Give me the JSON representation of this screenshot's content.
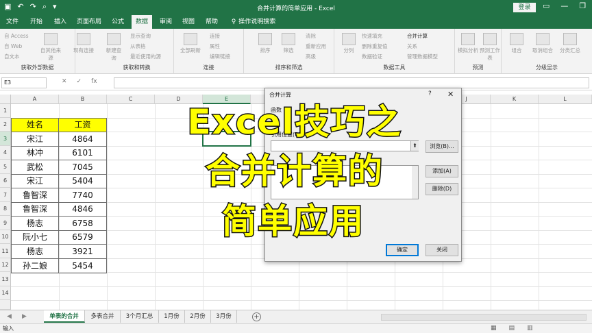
{
  "titlebar": {
    "title": "合并计算的简单应用 - Excel",
    "login": "登录",
    "qat": [
      "▣",
      "↶",
      "↷",
      "⌕",
      "▾"
    ],
    "win": [
      "▭",
      "—",
      "❐",
      "✕"
    ]
  },
  "tabs": [
    "文件",
    "开始",
    "插入",
    "页面布局",
    "公式",
    "数据",
    "审阅",
    "视图",
    "帮助",
    "操作说明搜索"
  ],
  "ribbon": {
    "groups": [
      {
        "label": "获取外部数据",
        "items": [
          "自 Access",
          "自 Web",
          "自文本",
          "自其他来源",
          "现有连接"
        ]
      },
      {
        "label": "获取和转换",
        "items": [
          "新建查询",
          "显示查询",
          "从表格",
          "最近使用的源"
        ]
      },
      {
        "label": "连接",
        "items": [
          "全部刷新",
          "连接",
          "属性",
          "编辑链接"
        ]
      },
      {
        "label": "排序和筛选",
        "items": [
          "排序",
          "筛选",
          "清除",
          "重新应用",
          "高级"
        ]
      },
      {
        "label": "数据工具",
        "items": [
          "分列",
          "快速填充",
          "删除重复值",
          "数据验证",
          "合并计算",
          "关系",
          "管理数据模型"
        ]
      },
      {
        "label": "预测",
        "items": [
          "模拟分析",
          "预测工作表"
        ]
      },
      {
        "label": "分级显示",
        "items": [
          "组合",
          "取消组合",
          "分类汇总"
        ]
      }
    ]
  },
  "formula_bar": {
    "name_box": "E3",
    "icons": [
      "✕",
      "✓",
      "fx"
    ]
  },
  "columns": [
    "A",
    "B",
    "C",
    "D",
    "E",
    "F",
    "G",
    "H",
    "I",
    "J",
    "K",
    "L"
  ],
  "rows": [
    "1",
    "2",
    "3",
    "4",
    "5",
    "6",
    "7",
    "8",
    "9",
    "10",
    "11",
    "12",
    "13",
    "14"
  ],
  "table": {
    "headers": [
      "姓名",
      "工资"
    ],
    "rows": [
      [
        "宋江",
        "4864"
      ],
      [
        "林冲",
        "6101"
      ],
      [
        "武松",
        "7045"
      ],
      [
        "宋江",
        "5404"
      ],
      [
        "鲁智深",
        "7740"
      ],
      [
        "鲁智深",
        "4846"
      ],
      [
        "杨志",
        "6758"
      ],
      [
        "阮小七",
        "6579"
      ],
      [
        "杨志",
        "3921"
      ],
      [
        "孙二娘",
        "5454"
      ]
    ]
  },
  "dialog": {
    "title": "合并计算",
    "help": "?",
    "close": "✕",
    "function_label": "函数",
    "ref_label": "引用位置(R):",
    "browse": "浏览(B)...",
    "add": "添加(A)",
    "delete": "删除(D)",
    "ok": "确定",
    "close_btn": "关闭"
  },
  "overlay": [
    "Excel技巧之",
    "合并计算的",
    "简单应用"
  ],
  "sheets": [
    "单表的合并",
    "多表合并",
    "3个月汇总",
    "1月份",
    "2月份",
    "3月份"
  ],
  "status": {
    "mode": "输入",
    "views": [
      "▦",
      "▤",
      "▥"
    ]
  }
}
